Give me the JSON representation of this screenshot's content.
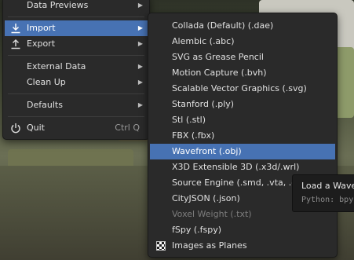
{
  "file_menu": {
    "items": [
      {
        "label": "Data Previews",
        "has_submenu": true
      },
      {
        "label": "Import",
        "has_submenu": true,
        "icon": "import-icon",
        "active": true
      },
      {
        "label": "Export",
        "has_submenu": true,
        "icon": "export-icon"
      },
      {
        "label": "External Data",
        "has_submenu": true
      },
      {
        "label": "Clean Up",
        "has_submenu": true
      },
      {
        "label": "Defaults",
        "has_submenu": true
      },
      {
        "label": "Quit",
        "shortcut": "Ctrl Q",
        "icon": "power-icon"
      }
    ]
  },
  "import_menu": {
    "items": [
      {
        "label": "Collada (Default) (.dae)"
      },
      {
        "label": "Alembic (.abc)"
      },
      {
        "label": "SVG as Grease Pencil"
      },
      {
        "label": "Motion Capture (.bvh)"
      },
      {
        "label": "Scalable Vector Graphics (.svg)"
      },
      {
        "label": "Stanford (.ply)"
      },
      {
        "label": "Stl (.stl)"
      },
      {
        "label": "FBX (.fbx)"
      },
      {
        "label": "Wavefront (.obj)",
        "highlighted": true
      },
      {
        "label": "X3D Extensible 3D (.x3d/.wrl)"
      },
      {
        "label": "Source Engine (.smd, .vta, .dm"
      },
      {
        "label": "CityJSON (.json)"
      },
      {
        "label": "Voxel Weight (.txt)",
        "disabled": true
      },
      {
        "label": "fSpy (.fspy)"
      },
      {
        "label": "Images as Planes",
        "icon": "checker-icon"
      }
    ]
  },
  "tooltip": {
    "title": "Load a Wavefr",
    "python": "Python: bpy"
  },
  "colors": {
    "menu_bg": "#2a2a2a",
    "highlight": "#4772b3",
    "text": "#e0e0e0",
    "disabled_text": "#7d7d7d"
  }
}
